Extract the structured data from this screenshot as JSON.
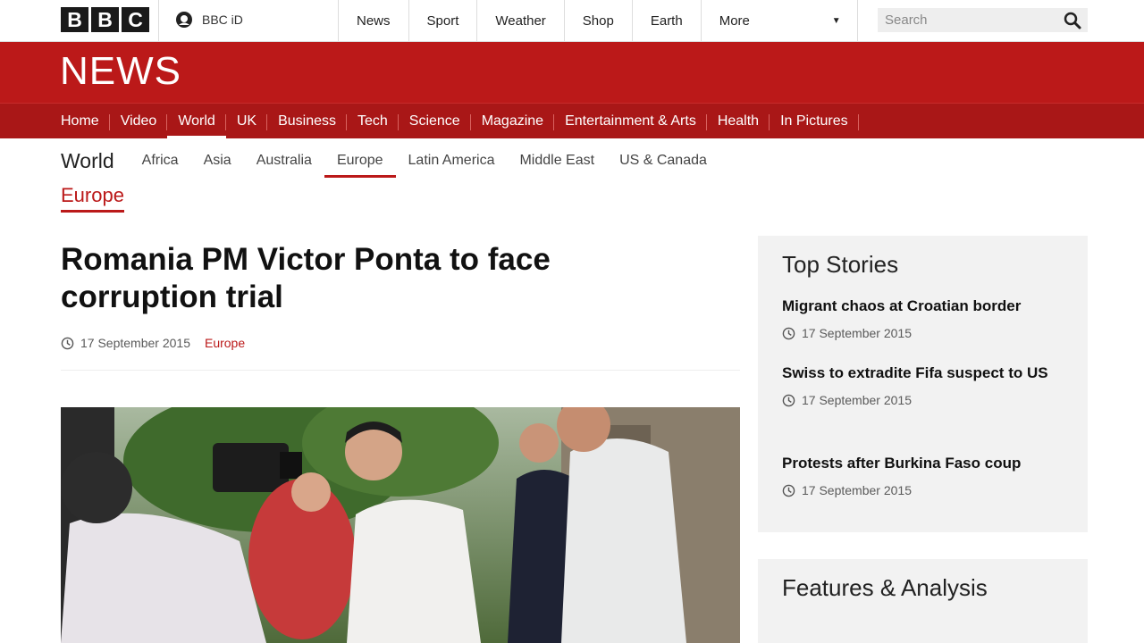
{
  "topbar": {
    "logo_letters": [
      "B",
      "B",
      "C"
    ],
    "bbcid_label": "BBC iD",
    "nav": [
      "News",
      "Sport",
      "Weather",
      "Shop",
      "Earth"
    ],
    "more_label": "More",
    "search_placeholder": "Search"
  },
  "banner": {
    "title": "NEWS"
  },
  "news_nav": [
    "Home",
    "Video",
    "World",
    "UK",
    "Business",
    "Tech",
    "Science",
    "Magazine",
    "Entertainment & Arts",
    "Health",
    "In Pictures"
  ],
  "world_nav": {
    "section": "World",
    "items": [
      "Africa",
      "Asia",
      "Australia",
      "Europe",
      "Latin America",
      "Middle East",
      "US & Canada"
    ]
  },
  "breadcrumb": "Europe",
  "article": {
    "headline": "Romania PM Victor Ponta to face corruption trial",
    "date": "17 September 2015",
    "section": "Europe"
  },
  "sidebar": {
    "top_title": "Top Stories",
    "stories": [
      {
        "title": "Migrant chaos at Croatian border",
        "date": "17 September 2015"
      },
      {
        "title": "Swiss to extradite Fifa suspect to US",
        "date": "17 September 2015"
      },
      {
        "title": "Protests after Burkina Faso coup",
        "date": "17 September 2015"
      }
    ],
    "features_title": "Features & Analysis"
  },
  "colors": {
    "brand_red": "#bb1919",
    "nav_red": "#a91717"
  }
}
